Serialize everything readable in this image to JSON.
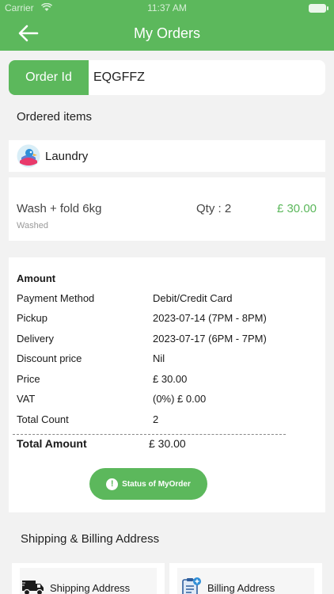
{
  "status_bar": {
    "carrier": "Carrier",
    "time": "11:37 AM"
  },
  "header": {
    "title": "My Orders",
    "back_icon": "arrow-left-icon"
  },
  "order": {
    "id_label": "Order Id",
    "id_value": "EQGFFZ"
  },
  "ordered_items": {
    "title": "Ordered items",
    "category": "Laundry",
    "items": [
      {
        "name": "Wash + fold 6kg",
        "status": "Washed",
        "qty": "Qty : 2",
        "price": "£ 30.00"
      }
    ]
  },
  "summary": {
    "heading": "Amount",
    "rows": [
      {
        "label": "Payment Method",
        "value": "Debit/Credit Card"
      },
      {
        "label": "Pickup",
        "value": "2023-07-14 (7PM - 8PM)"
      },
      {
        "label": "Delivery",
        "value": "2023-07-17 (6PM - 7PM)"
      },
      {
        "label": "Discount price",
        "value": "Nil"
      },
      {
        "label": "Price",
        "value": "£ 30.00"
      },
      {
        "label": "VAT",
        "value": "(0%) £ 0.00"
      },
      {
        "label": "Total Count",
        "value": "2"
      }
    ],
    "total_label": "Total Amount",
    "total_value": "£ 30.00",
    "status_button": "Status of MyOrder"
  },
  "address": {
    "title": "Shipping & Billing Address",
    "shipping_label": "Shipping Address",
    "billing_label": "Billing Address"
  },
  "colors": {
    "accent": "#5cb85c",
    "background": "#f2f2f2",
    "card": "#ffffff"
  }
}
